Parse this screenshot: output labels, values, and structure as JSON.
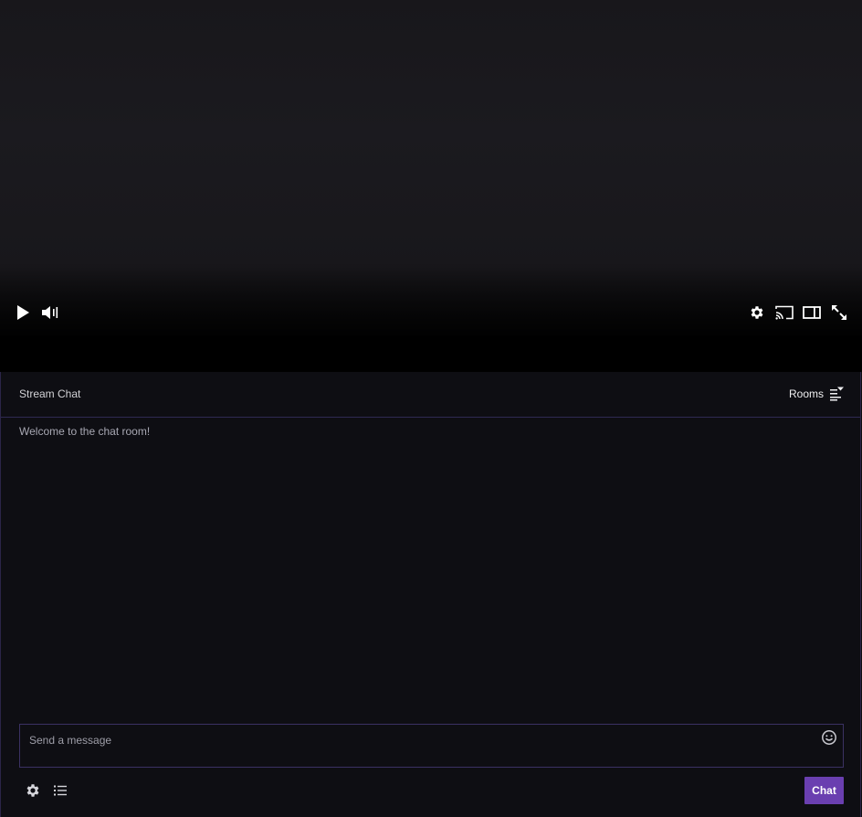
{
  "player": {
    "controls": {
      "play": "play-icon",
      "volume": "volume-icon",
      "settings": "gear-icon",
      "cast": "cast-icon",
      "theatre": "theatre-mode-icon",
      "fullscreen": "fullscreen-icon"
    }
  },
  "chat": {
    "title": "Stream Chat",
    "rooms_label": "Rooms",
    "messages": [
      {
        "text": "Welcome to the chat room!"
      }
    ],
    "input": {
      "placeholder": "Send a message",
      "value": ""
    },
    "send_label": "Chat"
  },
  "colors": {
    "accent": "#6a3fb0",
    "chat_border": "#2f2952",
    "background": "#0e0e13"
  }
}
